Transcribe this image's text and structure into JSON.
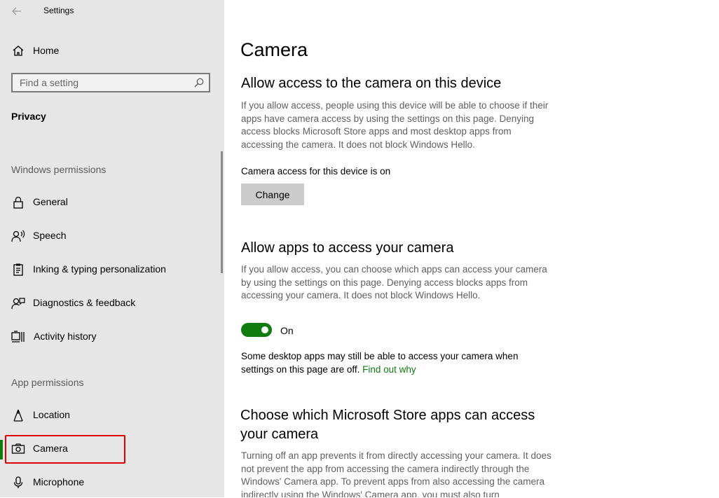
{
  "window": {
    "title": "Settings"
  },
  "sidebar": {
    "home_label": "Home",
    "search_placeholder": "Find a setting",
    "category": "Privacy",
    "windows_permissions": {
      "heading": "Windows permissions",
      "items": [
        {
          "label": "General",
          "icon": "lock-icon"
        },
        {
          "label": "Speech",
          "icon": "speech-icon"
        },
        {
          "label": "Inking & typing personalization",
          "icon": "clipboard-icon"
        },
        {
          "label": "Diagnostics & feedback",
          "icon": "feedback-icon"
        },
        {
          "label": "Activity history",
          "icon": "timeline-icon"
        }
      ]
    },
    "app_permissions": {
      "heading": "App permissions",
      "items": [
        {
          "label": "Location",
          "icon": "location-icon"
        },
        {
          "label": "Camera",
          "icon": "camera-icon",
          "selected": true
        },
        {
          "label": "Microphone",
          "icon": "microphone-icon"
        }
      ]
    }
  },
  "main": {
    "title": "Camera",
    "device_access": {
      "heading": "Allow access to the camera on this device",
      "description": "If you allow access, people using this device will be able to choose if their apps have camera access by using the settings on this page. Denying access blocks Microsoft Store apps and most desktop apps from accessing the camera. It does not block Windows Hello.",
      "status": "Camera access for this device is on",
      "change_label": "Change"
    },
    "app_access": {
      "heading": "Allow apps to access your camera",
      "description": "If you allow access, you can choose which apps can access your camera by using the settings on this page. Denying access blocks apps from accessing your camera. It does not block Windows Hello.",
      "toggle_state": "On",
      "note": "Some desktop apps may still be able to access your camera when settings on this page are off.",
      "link": "Find out why"
    },
    "store_apps": {
      "heading": "Choose which Microsoft Store apps can access your camera",
      "description": "Turning off an app prevents it from directly accessing your camera. It does not prevent the app from accessing the camera indirectly through the Windows' Camera app. To prevent apps from also accessing the camera indirectly using the Windows' Camera app, you must also turn"
    }
  },
  "colors": {
    "accent": "#107c10",
    "highlight": "#e00000",
    "sidebar_bg": "#e6e6e6"
  }
}
